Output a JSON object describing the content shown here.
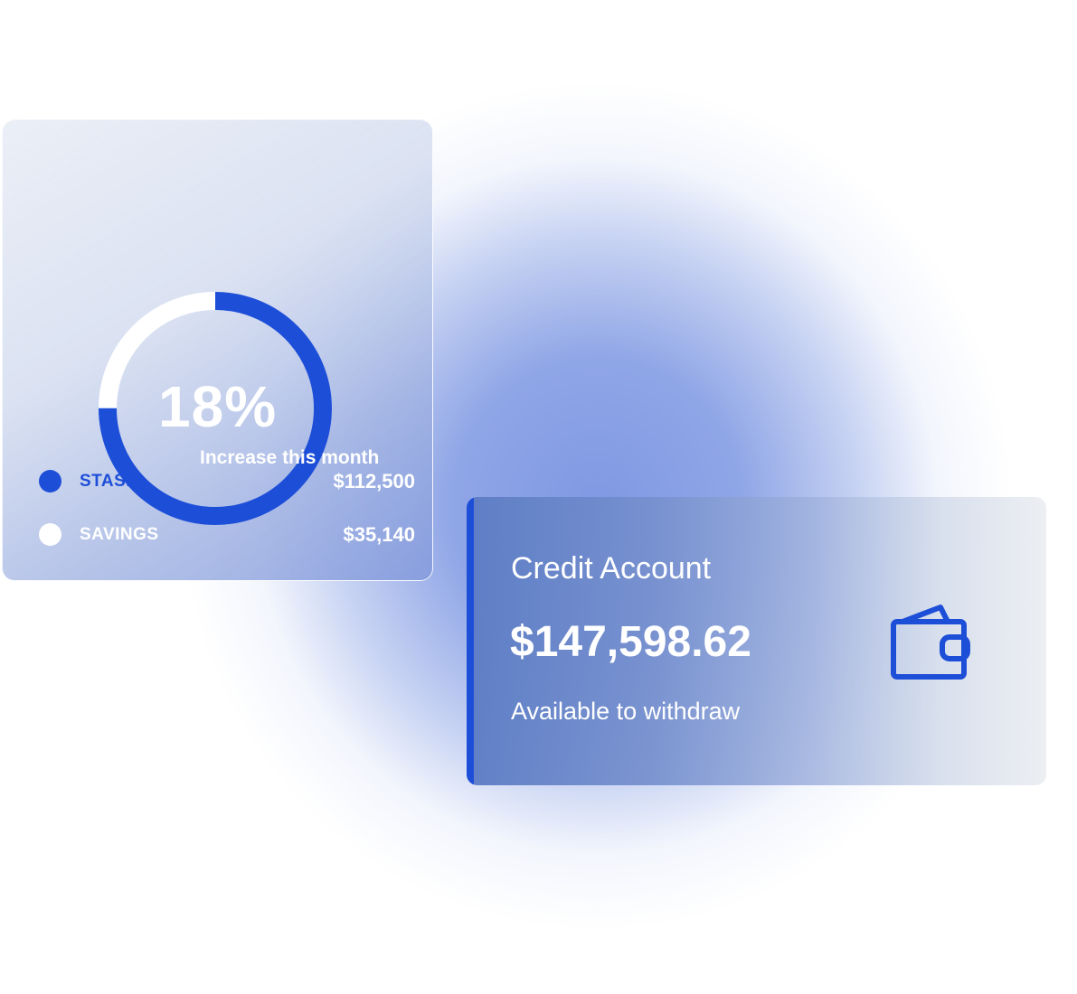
{
  "savings_card": {
    "percent_text": "18%",
    "caption": "Increase this month",
    "progress_fraction": 0.75,
    "colors": {
      "accent": "#1d4ed8",
      "track": "#ffffff"
    },
    "legend": [
      {
        "label": "STASH",
        "value": "$112,500",
        "dot_color": "#1d4ed8",
        "label_color": "#1d4ed8"
      },
      {
        "label": "SAVINGS",
        "value": "$35,140",
        "dot_color": "#ffffff",
        "label_color": "#ffffff"
      }
    ]
  },
  "credit_card": {
    "title": "Credit Account",
    "amount": "$147,598.62",
    "subtitle": "Available to withdraw",
    "icon": "wallet-icon",
    "accent_color": "#1d4ed8"
  }
}
